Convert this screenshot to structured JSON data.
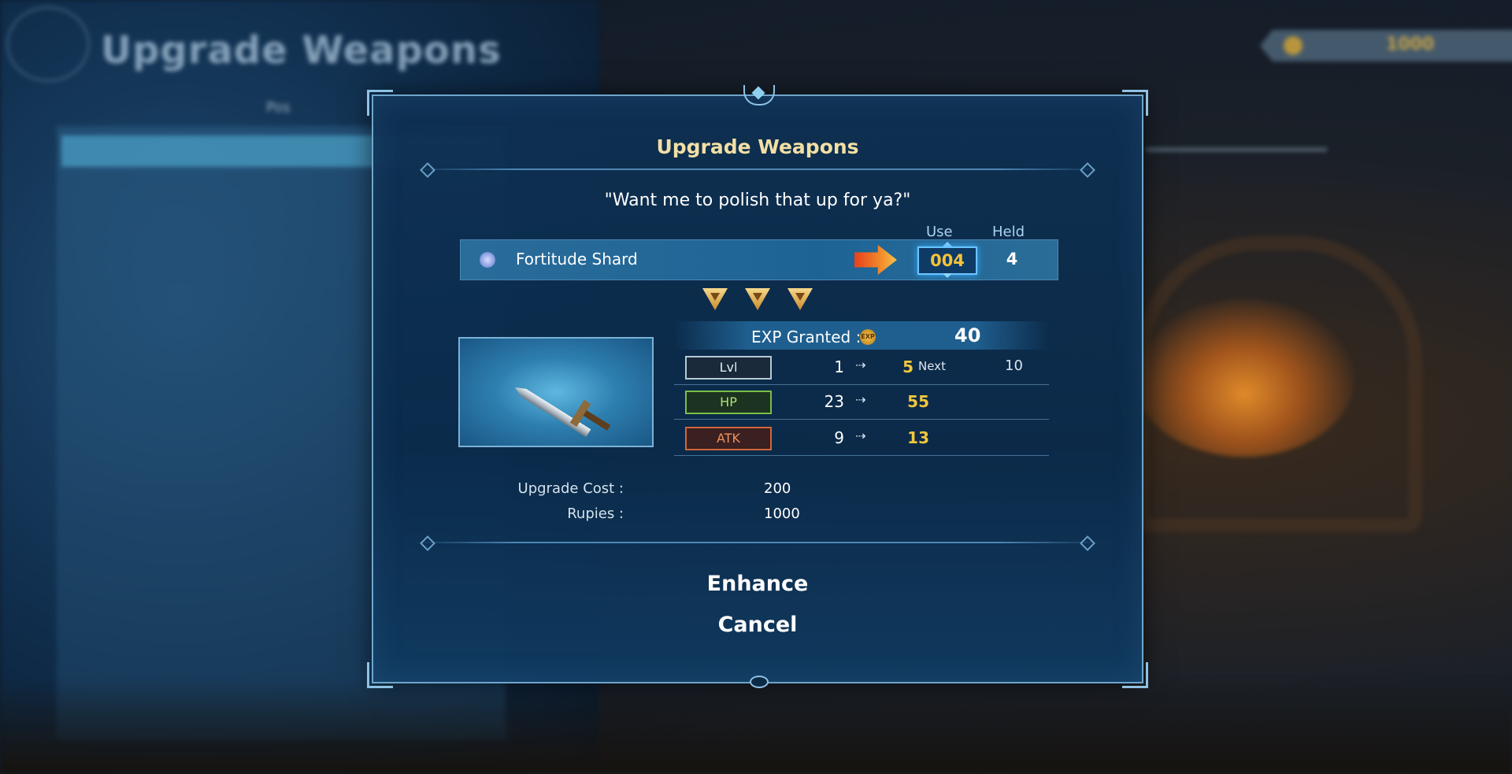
{
  "background": {
    "title": "Upgrade Weapons",
    "list_position_label": "Pos",
    "currency_value": "1000"
  },
  "dialog": {
    "title": "Upgrade Weapons",
    "quote": "\"Want me to polish that up for ya?\"",
    "column_use": "Use",
    "column_held": "Held",
    "item": {
      "name": "Fortitude Shard",
      "use": "004",
      "held": "4"
    },
    "rank_count": 3,
    "exp": {
      "label": "EXP Granted :",
      "icon_text": "EXP",
      "value": "40"
    },
    "stats": {
      "lvl": {
        "label": "Lvl",
        "current": "1",
        "arrow": "⇢",
        "new": "5",
        "next_label": "Next",
        "next_value": "10"
      },
      "hp": {
        "label": "HP",
        "current": "23",
        "arrow": "⇢",
        "new": "55"
      },
      "atk": {
        "label": "ATK",
        "current": "9",
        "arrow": "⇢",
        "new": "13"
      }
    },
    "upgrade_cost_label": "Upgrade Cost :",
    "upgrade_cost_value": "200",
    "rupies_label": "Rupies :",
    "rupies_value": "1000",
    "buttons": {
      "enhance": "Enhance",
      "cancel": "Cancel"
    }
  },
  "colors": {
    "title_gold": "#f2dfa4",
    "value_yellow": "#f2c73c",
    "hp_green": "#7ac048",
    "atk_orange": "#d0663a"
  }
}
